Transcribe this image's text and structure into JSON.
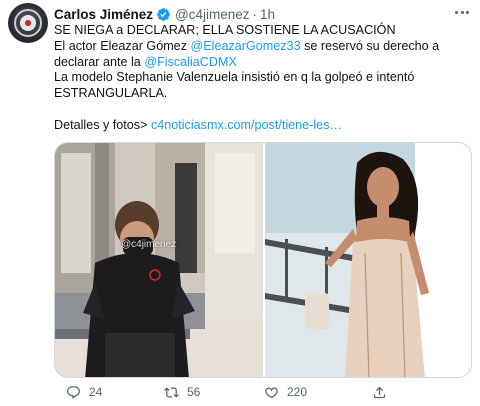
{
  "tweet": {
    "author_name": "Carlos Jiménez",
    "handle": "@c4jimenez",
    "separator": "·",
    "time": "1h",
    "lines": [
      {
        "parts": [
          {
            "text": "SE NIEGA a DECLARAR; ELLA SOSTIENE LA ACUSACIÓN",
            "link": false
          }
        ]
      },
      {
        "parts": [
          {
            "text": "El actor Eleazar Gómez ",
            "link": false
          },
          {
            "text": "@EleazarGomez33",
            "link": true
          },
          {
            "text": " se reservó su derecho a",
            "link": false
          }
        ]
      },
      {
        "parts": [
          {
            "text": "declarar ante la ",
            "link": false
          },
          {
            "text": "@FiscaliaCDMX",
            "link": true
          }
        ]
      },
      {
        "parts": [
          {
            "text": "La modelo Stephanie Valenzuela insistió en q la golpeó e intentó",
            "link": false
          }
        ]
      },
      {
        "parts": [
          {
            "text": "ESTRANGULARLA.",
            "link": false
          }
        ]
      },
      {
        "parts": []
      },
      {
        "parts": [
          {
            "text": "Detalles y fotos> ",
            "link": false
          },
          {
            "text": "c4noticiasmx.com/post/tiene-les…",
            "link": true
          }
        ]
      }
    ],
    "media": {
      "watermark": "@c4jimenez"
    },
    "actions": {
      "reply_count": "24",
      "retweet_count": "56",
      "like_count": "220"
    }
  },
  "colors": {
    "link": "#1d9bf0",
    "verified": "#1d9bf0",
    "secondary_text": "#536471"
  },
  "icons": [
    "avatar",
    "verified-badge-icon",
    "more-icon",
    "reply-icon",
    "retweet-icon",
    "like-icon",
    "share-icon"
  ]
}
